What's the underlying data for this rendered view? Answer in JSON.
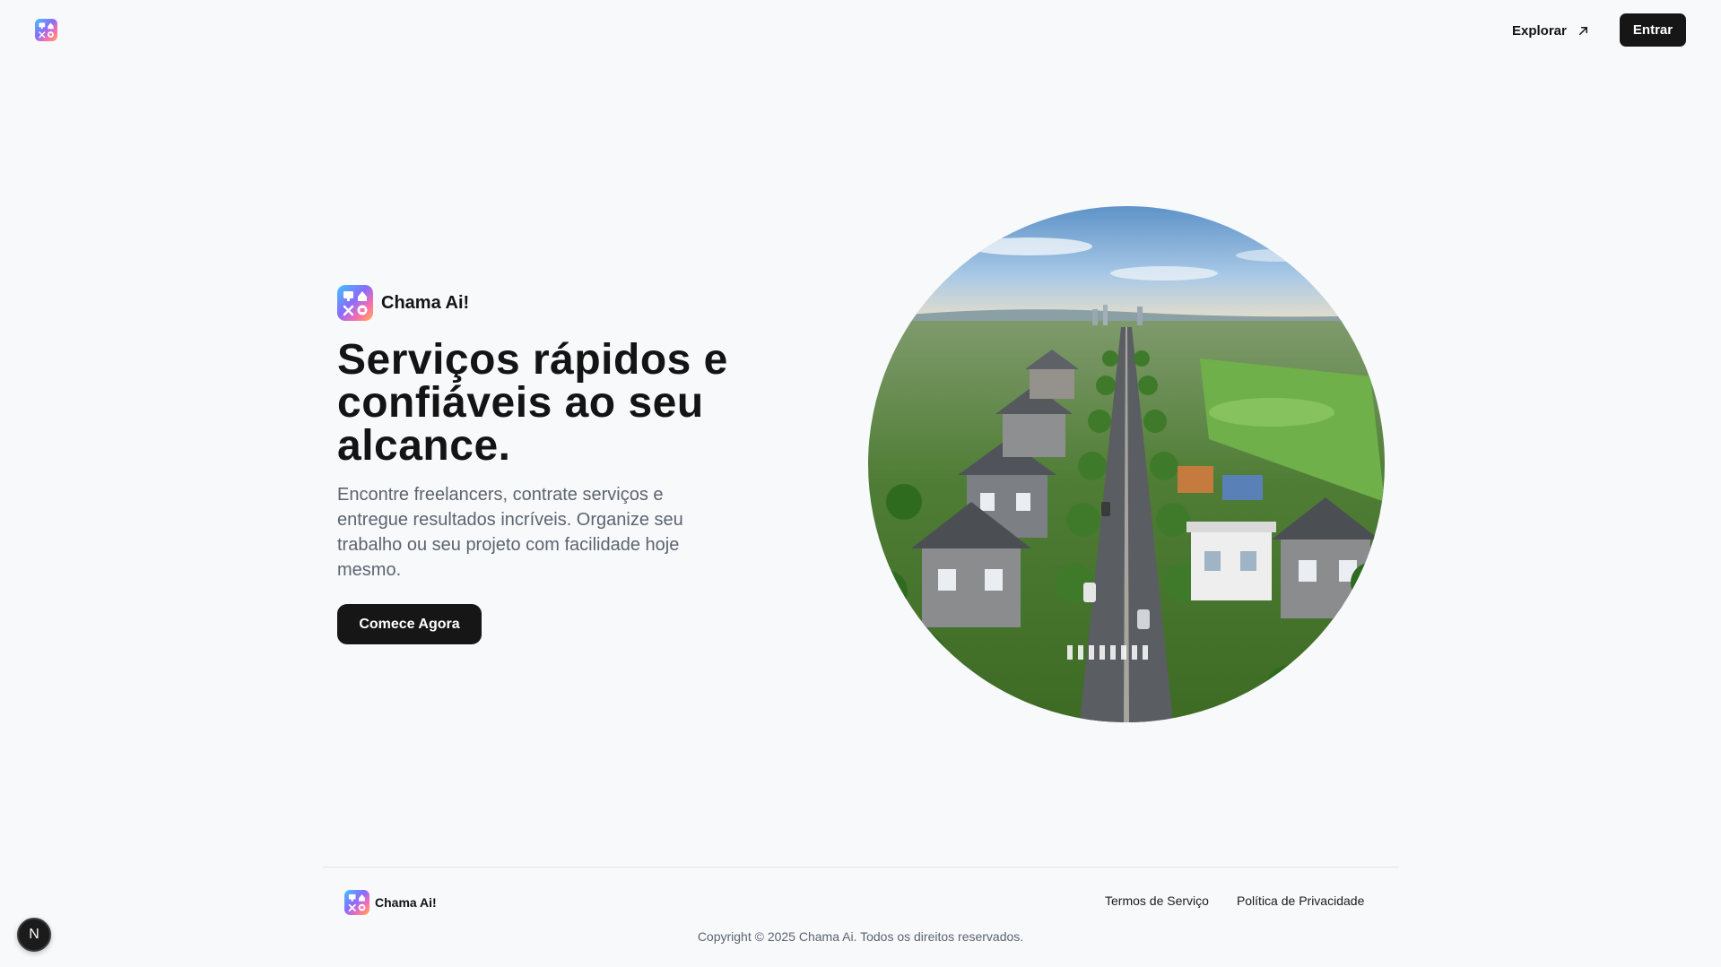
{
  "header": {
    "logo_icon": "app-grid-logo-icon",
    "explore_label": "Explorar",
    "explore_icon": "arrow-up-right-icon",
    "enter_label": "Entrar"
  },
  "hero": {
    "brand_name": "Chama Ai!",
    "title_line1": "Serviços rápidos e",
    "title_line2": "confiáveis ao seu",
    "title_line3": "alcance.",
    "subtitle": "Encontre freelancers, contrate serviços e entregue resultados incríveis. Organize seu trabalho ou seu projeto com facilidade hoje mesmo.",
    "cta_label": "Comece Agora",
    "image_icon": "suburban-neighborhood-aerial-image"
  },
  "footer": {
    "brand_name": "Chama Ai!",
    "links": [
      "Termos de Serviço",
      "Política de Privacidade"
    ],
    "copyright": "Copyright © 2025 Chama Ai. Todos os direitos reservados."
  },
  "dev_badge": {
    "label": "N"
  },
  "colors": {
    "background": "#f7f9fb",
    "primary_button": "#161616",
    "text": "#141414",
    "muted_text": "#5d6470",
    "logo_gradient": [
      "#3fb5ff",
      "#7b5cff",
      "#ff6fa8",
      "#ffb347"
    ]
  }
}
